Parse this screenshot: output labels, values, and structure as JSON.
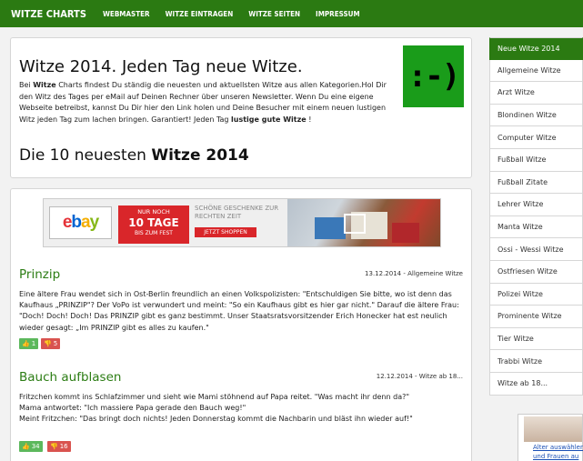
{
  "topnav": {
    "brand": "WITZE CHARTS",
    "links": [
      "WEBMASTER",
      "WITZE EINTRAGEN",
      "WITZE SEITEN",
      "IMPRESSUM"
    ]
  },
  "intro": {
    "title": "Witze 2014. Jeden Tag neue Witze.",
    "logo_text": ":-)",
    "text_pre": "Bei ",
    "text_bold": "Witze",
    "text_mid": " Charts findest Du ständig die neuesten und aktuellsten Witze aus allen Kategorien.Hol Dir den Witz des Tages per eMail auf Deinen Rechner über unseren Newsletter. Wenn Du eine eigene Webseite betreibst, kannst Du Dir hier den Link holen und Deine Besucher mit einem neuen lustigen Witz jeden Tag zum lachen bringen. Garantiert! Jeden Tag ",
    "text_bold2": "lustige gute Witze",
    "text_end": " !",
    "subtitle_pre": "Die 10 neuesten ",
    "subtitle_bold": "Witze 2014"
  },
  "banner": {
    "ebay": "ebay",
    "red_line1": "NUR NOCH",
    "red_line2": "10 TAGE",
    "red_line3": "BIS ZUM FEST",
    "gift_text": "SCHÖNE GESCHENKE ZUR RECHTEN ZEIT",
    "gift_button": "JETZT SHOPPEN"
  },
  "jokes": [
    {
      "title": "Prinzip",
      "meta": "13.12.2014 - Allgemeine Witze",
      "text": "Eine ältere Frau wendet sich in Ost-Berlin freundlich an einen Volkspolizisten: \"Entschuldigen Sie bitte, wo ist denn das Kaufhaus „PRINZIP\"? Der VoPo ist verwundert und meint: \"So ein Kaufhaus gibt es hier gar nicht.\" Darauf die ältere Frau: \"Doch! Doch! Doch! Das PRINZIP gibt es ganz bestimmt. Unser Staatsratsvorsitzender Erich Honecker hat est neulich wieder gesagt: „Im PRINZIP gibt es alles zu kaufen.\"",
      "up": "1",
      "down": "5"
    },
    {
      "title": "Bauch aufblasen",
      "meta": "12.12.2014 - Witze ab 18...",
      "text_line1": "Fritzchen kommt ins Schlafzimmer und sieht wie Mami stöhnend auf Papa reitet. \"Was macht ihr denn da?\"",
      "text_line2": "Mama antwortet: \"Ich massiere Papa gerade den Bauch weg!\"",
      "text_line3": "Meint Fritzchen: \"Das bringt doch nichts! Jeden Donnerstag kommt die Nachbarin und bläst ihn wieder auf!\"",
      "up": "34",
      "down": "16"
    }
  ],
  "sidebar": {
    "items": [
      "Neue Witze 2014",
      "Allgemeine Witze",
      "Arzt Witze",
      "Blondinen Witze",
      "Computer Witze",
      "Fußball Witze",
      "Fußball Zitate",
      "Lehrer Witze",
      "Manta Witze",
      "Ossi - Wessi Witze",
      "Ostfriesen Witze",
      "Polizei Witze",
      "Prominente Witze",
      "Tier Witze",
      "Trabbi Witze",
      "Witze ab 18..."
    ]
  },
  "ad": {
    "line1": "Alter auswählen",
    "line2": "und Frauen au"
  },
  "colors": {
    "brand_green": "#2b7a12",
    "title_green": "#2c7d14",
    "vote_up": "#5cb85c",
    "vote_down": "#d9534f"
  }
}
